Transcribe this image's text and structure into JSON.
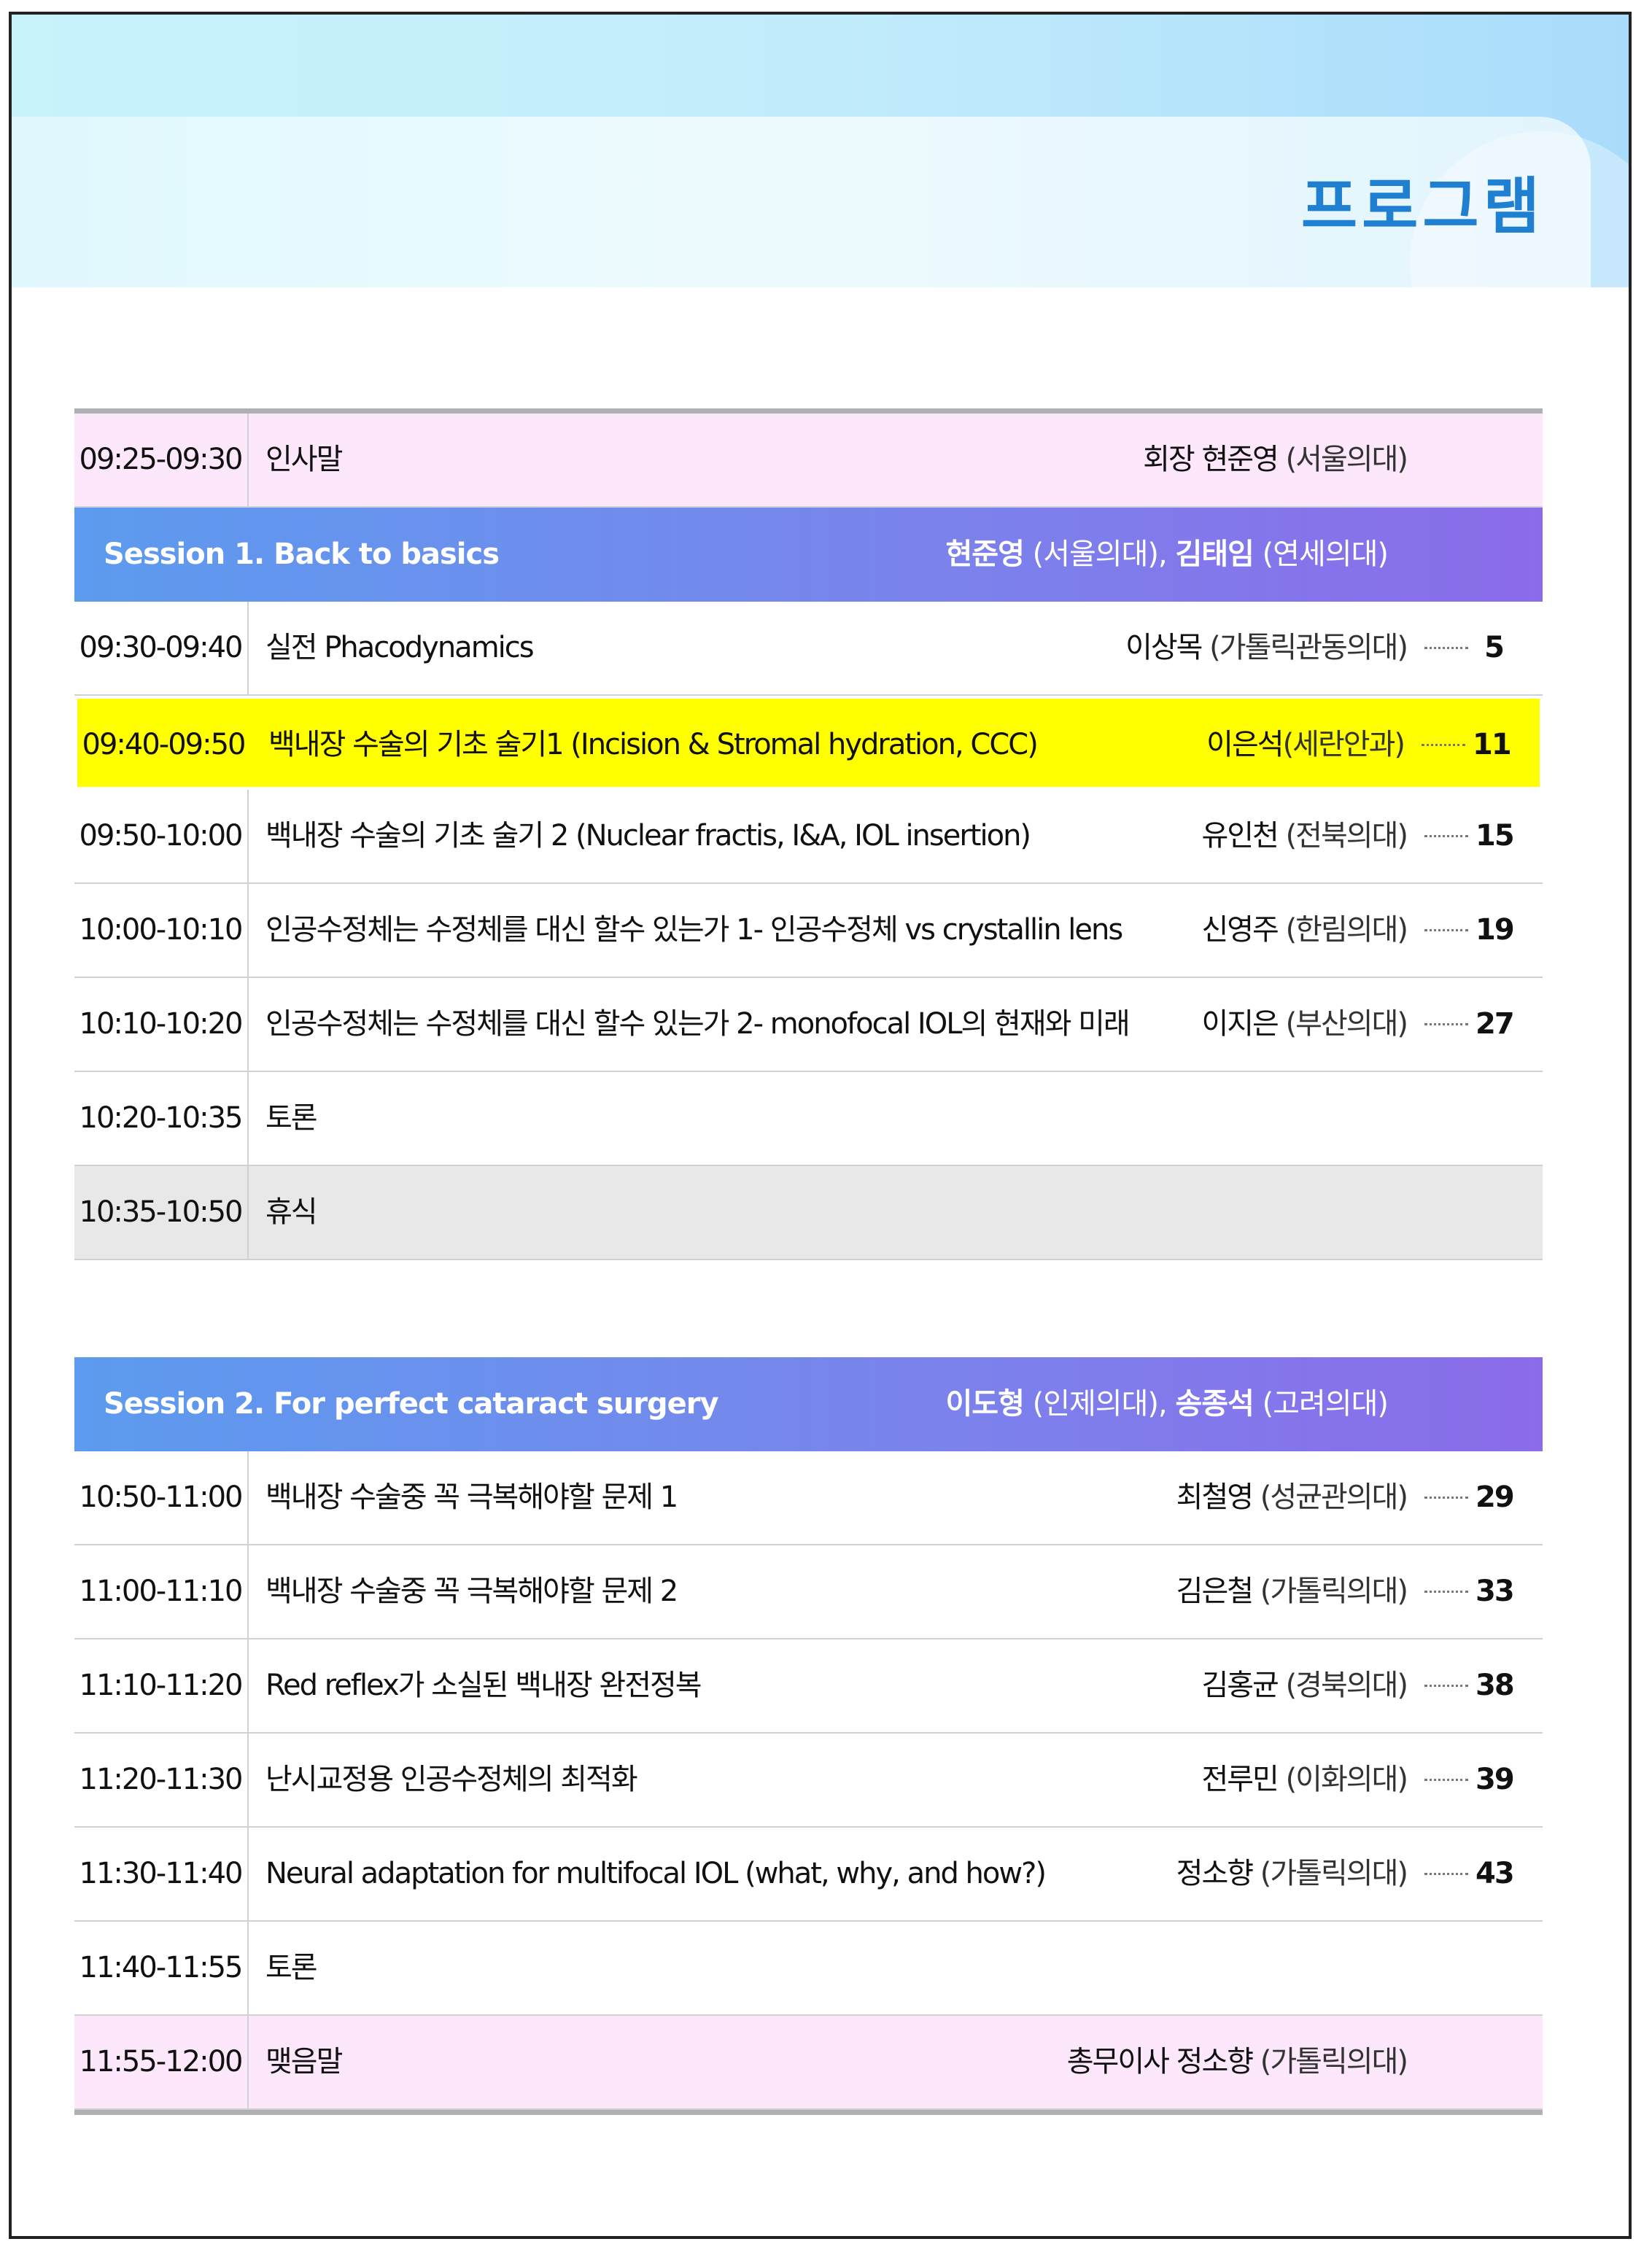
{
  "header": {
    "title": "프로그램"
  },
  "program1": [
    {
      "type": "row",
      "style": "pink",
      "time": "09:25-09:30",
      "topic": "인사말",
      "speaker_pre": "회장 ",
      "speaker": "현준영",
      "aff": " (서울의대)",
      "page": ""
    },
    {
      "type": "session",
      "title": "Session 1. Back to basics",
      "chair1": "현준영",
      "chair1_aff": " (서울의대), ",
      "chair2": "김태임",
      "chair2_aff": " (연세의대)"
    },
    {
      "type": "row",
      "style": "",
      "time": "09:30-09:40",
      "topic": "실전 Phacodynamics",
      "speaker_pre": "",
      "speaker": "이상목",
      "aff": " (가톨릭관동의대)",
      "page": "5"
    },
    {
      "type": "row",
      "style": "yellow",
      "time": "09:40-09:50",
      "topic": "백내장 수술의 기초 술기1 (Incision & Stromal hydration, CCC)",
      "speaker_pre": "",
      "speaker": "이은석",
      "aff": "(세란안과)",
      "page": "11"
    },
    {
      "type": "row",
      "style": "",
      "time": "09:50-10:00",
      "topic": "백내장 수술의 기초 술기 2 (Nuclear fractis, I&A, IOL insertion)",
      "speaker_pre": "",
      "speaker": "유인천",
      "aff": " (전북의대)",
      "page": "15"
    },
    {
      "type": "row",
      "style": "",
      "time": "10:00-10:10",
      "topic": "인공수정체는 수정체를 대신 할수 있는가 1- 인공수정체 vs crystallin lens",
      "speaker_pre": "",
      "speaker": "신영주",
      "aff": " (한림의대)",
      "page": "19"
    },
    {
      "type": "row",
      "style": "",
      "time": "10:10-10:20",
      "topic": "인공수정체는 수정체를 대신 할수 있는가 2- monofocal IOL의 현재와 미래",
      "speaker_pre": "",
      "speaker": "이지은",
      "aff": " (부산의대)",
      "page": "27"
    },
    {
      "type": "row",
      "style": "",
      "time": "10:20-10:35",
      "topic": "토론",
      "speaker_pre": "",
      "speaker": "",
      "aff": "",
      "page": ""
    },
    {
      "type": "row",
      "style": "gray",
      "time": "10:35-10:50",
      "topic": "휴식",
      "speaker_pre": "",
      "speaker": "",
      "aff": "",
      "page": ""
    }
  ],
  "program2": [
    {
      "type": "session",
      "title": "Session 2. For perfect cataract surgery",
      "chair1": "이도형",
      "chair1_aff": " (인제의대), ",
      "chair2": "송종석",
      "chair2_aff": " (고려의대)"
    },
    {
      "type": "row",
      "style": "",
      "time": "10:50-11:00",
      "topic": "백내장 수술중 꼭 극복해야할 문제 1",
      "speaker_pre": "",
      "speaker": "최철영",
      "aff": " (성균관의대)",
      "page": "29"
    },
    {
      "type": "row",
      "style": "",
      "time": "11:00-11:10",
      "topic": "백내장 수술중 꼭 극복해야할 문제 2",
      "speaker_pre": "",
      "speaker": "김은철",
      "aff": " (가톨릭의대)",
      "page": "33"
    },
    {
      "type": "row",
      "style": "",
      "time": "11:10-11:20",
      "topic": "Red reflex가 소실된 백내장 완전정복",
      "speaker_pre": "",
      "speaker": "김홍균",
      "aff": " (경북의대)",
      "page": "38"
    },
    {
      "type": "row",
      "style": "",
      "time": "11:20-11:30",
      "topic": "난시교정용 인공수정체의 최적화",
      "speaker_pre": "",
      "speaker": "전루민",
      "aff": " (이화의대)",
      "page": "39"
    },
    {
      "type": "row",
      "style": "",
      "time": "11:30-11:40",
      "topic": "Neural adaptation for multifocal IOL (what, why, and how?)",
      "speaker_pre": "",
      "speaker": "정소향",
      "aff": " (가톨릭의대)",
      "page": "43"
    },
    {
      "type": "row",
      "style": "",
      "time": "11:40-11:55",
      "topic": "토론",
      "speaker_pre": "",
      "speaker": "",
      "aff": "",
      "page": ""
    },
    {
      "type": "row",
      "style": "pink",
      "time": "11:55-12:00",
      "topic": "맺음말",
      "speaker_pre": "총무이사 ",
      "speaker": "정소향",
      "aff": " (가톨릭의대)",
      "page": ""
    }
  ]
}
